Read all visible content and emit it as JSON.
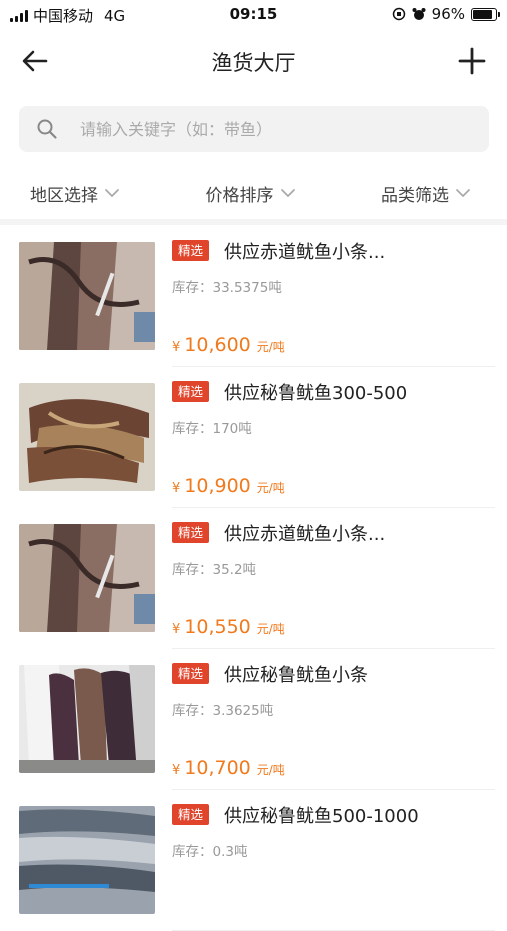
{
  "status_bar": {
    "carrier": "中国移动",
    "network": "4G",
    "time": "09:15",
    "battery": "96%",
    "battery_level": 0.96
  },
  "nav": {
    "title": "渔货大厅"
  },
  "search": {
    "placeholder": "请输入关键字（如：带鱼）"
  },
  "filters": [
    {
      "label": "地区选择"
    },
    {
      "label": "价格排序"
    },
    {
      "label": "品类筛选"
    }
  ],
  "stock_label": "库存：",
  "currency": "¥",
  "unit": "元/吨",
  "products": [
    {
      "badge": "精选",
      "title": "供应赤道鱿鱼小条...",
      "stock": "33.5375吨",
      "price": "10,600",
      "image": "squid-photo"
    },
    {
      "badge": "精选",
      "title": "供应秘鲁鱿鱼300-500",
      "stock": "170吨",
      "price": "10,900",
      "image": "squid-photo"
    },
    {
      "badge": "精选",
      "title": "供应赤道鱿鱼小条...",
      "stock": "35.2吨",
      "price": "10,550",
      "image": "squid-photo"
    },
    {
      "badge": "精选",
      "title": "供应秘鲁鱿鱼小条",
      "stock": "3.3625吨",
      "price": "10,700",
      "image": "squid-photo"
    },
    {
      "badge": "精选",
      "title": "供应秘鲁鱿鱼500-1000",
      "stock": "0.3吨",
      "price": "",
      "image": "squid-photo"
    }
  ],
  "colors": {
    "badge": "#e0452c",
    "price": "#f07a1e"
  }
}
